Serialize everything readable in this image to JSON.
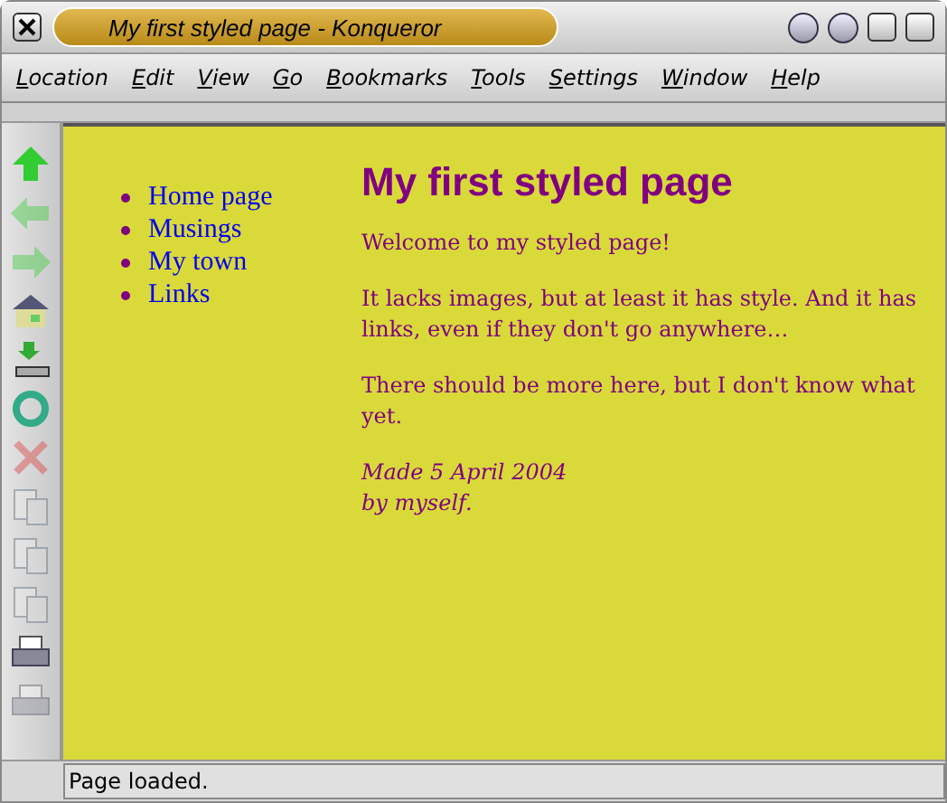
{
  "window": {
    "title": "My first styled page - Konqueror"
  },
  "menu": [
    "Location",
    "Edit",
    "View",
    "Go",
    "Bookmarks",
    "Tools",
    "Settings",
    "Window",
    "Help"
  ],
  "toolbar": [
    {
      "kind": "up",
      "disabled": false
    },
    {
      "kind": "back",
      "disabled": true
    },
    {
      "kind": "forward",
      "disabled": true
    },
    {
      "kind": "home",
      "disabled": false
    },
    {
      "kind": "download",
      "disabled": false
    },
    {
      "kind": "reload",
      "disabled": false
    },
    {
      "kind": "stop",
      "disabled": true
    },
    {
      "kind": "doc",
      "disabled": true
    },
    {
      "kind": "doc",
      "disabled": true
    },
    {
      "kind": "doc",
      "disabled": true
    },
    {
      "kind": "print",
      "disabled": false
    },
    {
      "kind": "print",
      "disabled": true
    }
  ],
  "page": {
    "nav": [
      "Home page",
      "Musings",
      "My town",
      "Links"
    ],
    "heading": "My first styled page",
    "paragraphs": [
      "Welcome to my styled page!",
      "It lacks images, but at least it has style. And it has links, even if they don't go anywhere…",
      "There should be more here, but I don't know what yet."
    ],
    "signature": [
      "Made 5 April 2004",
      "by myself."
    ]
  },
  "status_bar": "Page loaded."
}
